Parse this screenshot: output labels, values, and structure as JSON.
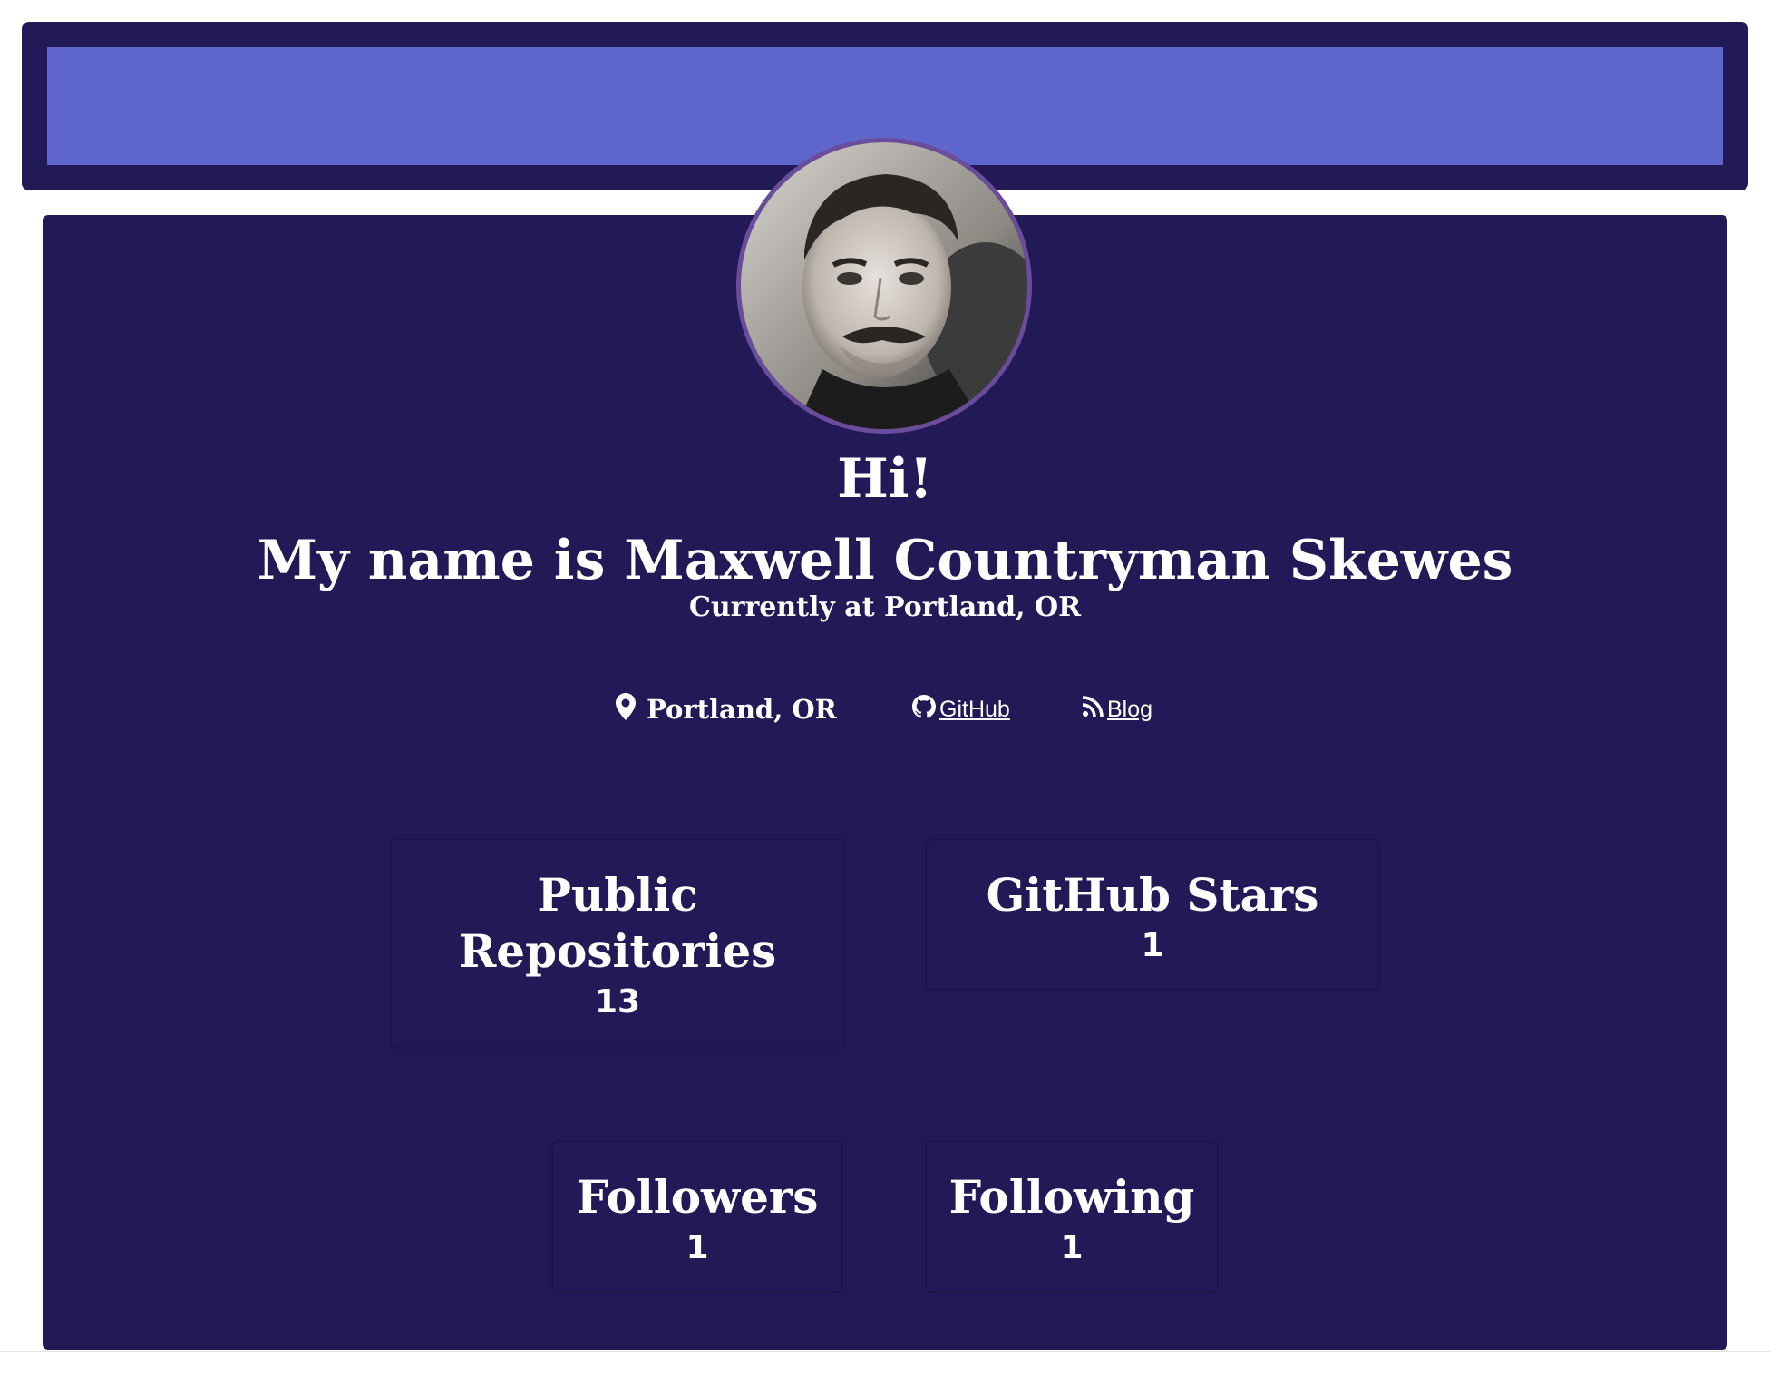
{
  "profile": {
    "greeting": "Hi!",
    "name_line": "My name is Maxwell Countryman Skewes",
    "subtitle": "Currently at Portland, OR",
    "avatar_alt": "Profile photo"
  },
  "info": {
    "location": "Portland, OR",
    "github_label": "GitHub",
    "blog_label": "Blog"
  },
  "stats": {
    "repos_label": "Public Repositories",
    "repos_value": "13",
    "stars_label": "GitHub Stars",
    "stars_value": "1",
    "followers_label": "Followers",
    "followers_value": "1",
    "following_label": "Following",
    "following_value": "1"
  },
  "colors": {
    "background": "#ffffff",
    "card": "#211a57",
    "banner_inner": "#5e66cc",
    "avatar_border": "#6a4b9c",
    "text": "#ffffff"
  },
  "icons": {
    "location": "map-pin-icon",
    "github": "github-icon",
    "blog": "rss-icon"
  }
}
